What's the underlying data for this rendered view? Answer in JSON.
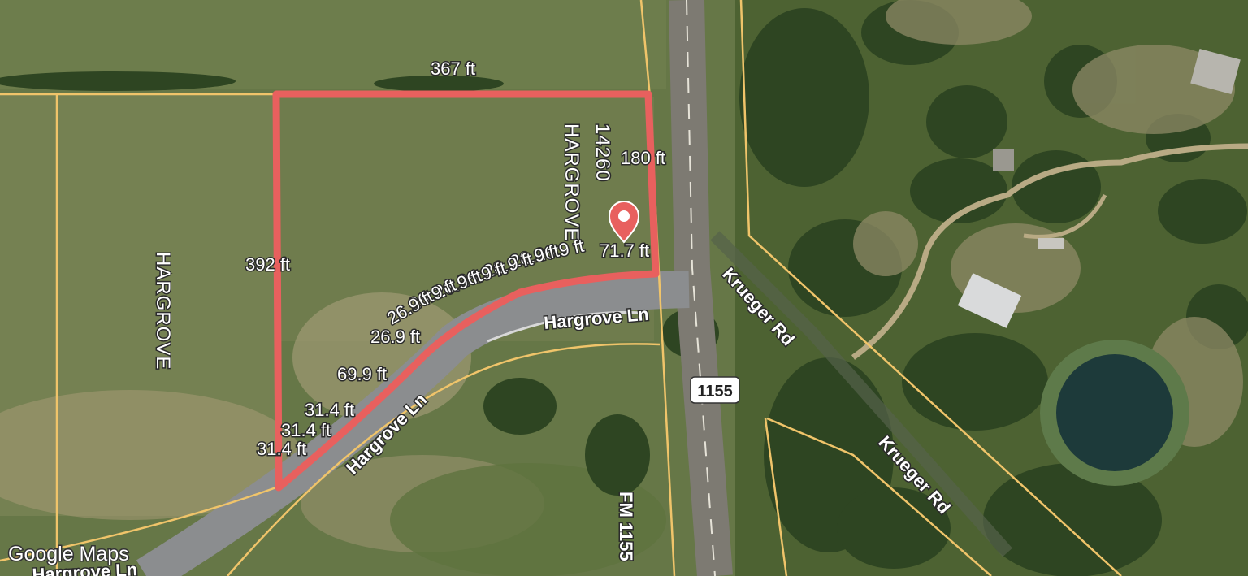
{
  "brand": "Google Maps",
  "colors": {
    "boundary": "#e8605e",
    "parcel_line": "#f0c46a",
    "pin": "#e8605e"
  },
  "parcels": {
    "west": "HARGROVE",
    "main_owner": "HARGROVE",
    "main_number": "14260"
  },
  "roads": {
    "hargrove_1": "Hargrove Ln",
    "hargrove_2": "Hargrove Ln",
    "hargrove_3": "Hargrove Ln",
    "krueger_1": "Krueger Rd",
    "krueger_2": "Krueger Rd",
    "fm": "FM 1155",
    "route_shield": "1155"
  },
  "measurements": {
    "top": "367 ft",
    "right": "180 ft",
    "left": "392 ft",
    "corner": "71.7 ft",
    "c1": "26.9 ft",
    "c2": "26.9 ft",
    "c3": "26.9 ft",
    "c4": "26.9 ft",
    "c5": "26.9 ft",
    "c6": "26.9 ft",
    "c7": "26.9 ft",
    "curve_long": "69.9 ft",
    "s1": "31.4 ft",
    "s2": "31.4 ft",
    "s3": "31.4 ft"
  }
}
